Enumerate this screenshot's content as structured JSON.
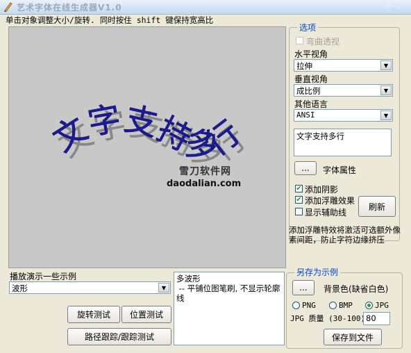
{
  "window": {
    "title": "艺术字体在线生成器V1.0"
  },
  "hint": "单击对象调整大小/旋转.  同时按住 shift 键保持宽高比",
  "canvas": {
    "art_text": "文字支持多行",
    "watermark_cn": "雪刀软件网",
    "watermark_en": "daodalian.com"
  },
  "options": {
    "title": "选项",
    "bend_label": "弯曲透视",
    "horizontal_label": "水平视角",
    "horizontal_value": "拉伸",
    "vertical_label": "垂直视角",
    "vertical_value": "成比例",
    "language_label": "其他语言",
    "language_value": "ANSI",
    "text_value": "文字支持多行",
    "font_button": "...",
    "font_label": "字体属性",
    "shadow_label": "添加阴影",
    "emboss_label": "添加浮雕效果",
    "guides_label": "显示辅助线",
    "refresh_label": "刷新",
    "note": "添加浮雕特效将激活可选额外像素间距，防止字符边缘挤压"
  },
  "demo": {
    "label": "播放演示一些示例",
    "selected": "波形",
    "description": "多波形\n -- 平铺位图笔刷, 不显示轮廓线",
    "rotate_button": "旋转测试",
    "position_button": "位置测试",
    "path_button": "路径跟踪/跟踪测试"
  },
  "save": {
    "title": "另存为示例",
    "bg_button": "...",
    "bg_label": "背景色(缺省白色)",
    "formats": [
      "PNG",
      "BMP",
      "JPG"
    ],
    "selected_format": "JPG",
    "quality_label": "JPG 质量 (30-100)",
    "quality_value": "80",
    "save_button": "保存到文件"
  }
}
